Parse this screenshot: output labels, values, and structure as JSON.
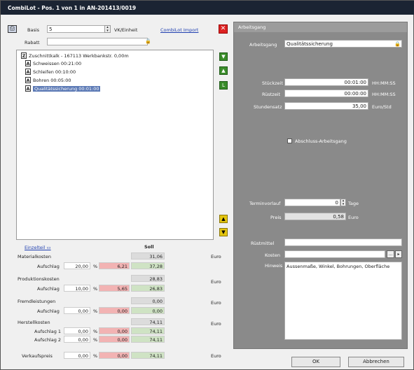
{
  "window": {
    "title": "CombiLot - Pos. 1 von 1 in AN-201413/0019"
  },
  "left": {
    "basis_label": "Basis",
    "basis_value": "5",
    "unit": "VK/Einheit",
    "link": "CombiLot Import",
    "rabatt_label": "Rabatt",
    "tree": [
      {
        "icon": "Z",
        "text": "Zuschnittkalk - 167113 Werkbankstr. 0,00m"
      },
      {
        "icon": "A",
        "text": "Schweissen 00:21:00"
      },
      {
        "icon": "A",
        "text": "Schleifen 00:10:00"
      },
      {
        "icon": "A",
        "text": "Bohren 00:05:00"
      },
      {
        "icon": "A",
        "text": "Qualitätssicherung 00:01:00"
      }
    ]
  },
  "costs": {
    "link": "Einzelteil ▭",
    "soll_header": "Soll",
    "materialkosten": {
      "label": "Materialkosten",
      "soll": "31,06",
      "unit": "Euro"
    },
    "mat_aufschlag": {
      "label": "Aufschlag",
      "pct": "20,00",
      "sym": "%",
      "red": "6,21",
      "soll": "37,28"
    },
    "produktionskosten": {
      "label": "Produktionskosten",
      "soll": "28,83",
      "unit": "Euro"
    },
    "prod_aufschlag": {
      "label": "Aufschlag",
      "pct": "10,00",
      "sym": "%",
      "red": "5,65",
      "soll": "26,83"
    },
    "fremd": {
      "label": "Fremdleistungen",
      "soll": "0,00",
      "unit": "Euro"
    },
    "fremd_aufschlag": {
      "label": "Aufschlag",
      "pct": "0,00",
      "sym": "%",
      "red": "0,00",
      "soll": "0,00"
    },
    "herstell": {
      "label": "Herstellkosten",
      "soll": "74,11",
      "unit": "Euro"
    },
    "aufschlag1": {
      "label": "Aufschlag 1",
      "pct": "0,00",
      "sym": "%",
      "red": "0,00",
      "soll": "74,11"
    },
    "aufschlag2": {
      "label": "Aufschlag 2",
      "pct": "0,00",
      "sym": "%",
      "red": "0,00",
      "soll": "74,11"
    },
    "verkauf": {
      "label": "Verkaufspreis",
      "pct": "0,00",
      "sym": "%",
      "red": "0,00",
      "soll": "74,11",
      "unit": "Euro"
    }
  },
  "right": {
    "header": "Arbeitsgang",
    "ag_label": "Arbeitsgang",
    "ag_value": "Qualitätssicherung",
    "stueck_label": "Stückzeit",
    "stueck_value": "00:01:00",
    "stueck_unit": "HH:MM:SS",
    "ruest_label": "Rüstzeit",
    "ruest_value": "00:00:00",
    "ruest_unit": "HH:MM:SS",
    "stunden_label": "Stundensatz",
    "stunden_value": "35,00",
    "stunden_unit": "Euro/Std",
    "abschluss": "Abschluss-Arbeitsgang",
    "termin_label": "Terminvorlauf",
    "termin_value": "0",
    "termin_unit": "Tage",
    "preis_label": "Preis",
    "preis_value": "0,58",
    "preis_unit": "Euro",
    "ruestmittel_label": "Rüstmittel",
    "kosten_label": "Kosten",
    "hinweis_label": "Hinweis",
    "hinweis_text": "Aussenmaße, Winkel, Bohrungen, Oberfläche"
  },
  "buttons": {
    "ok": "OK",
    "cancel": "Abbrechen"
  }
}
